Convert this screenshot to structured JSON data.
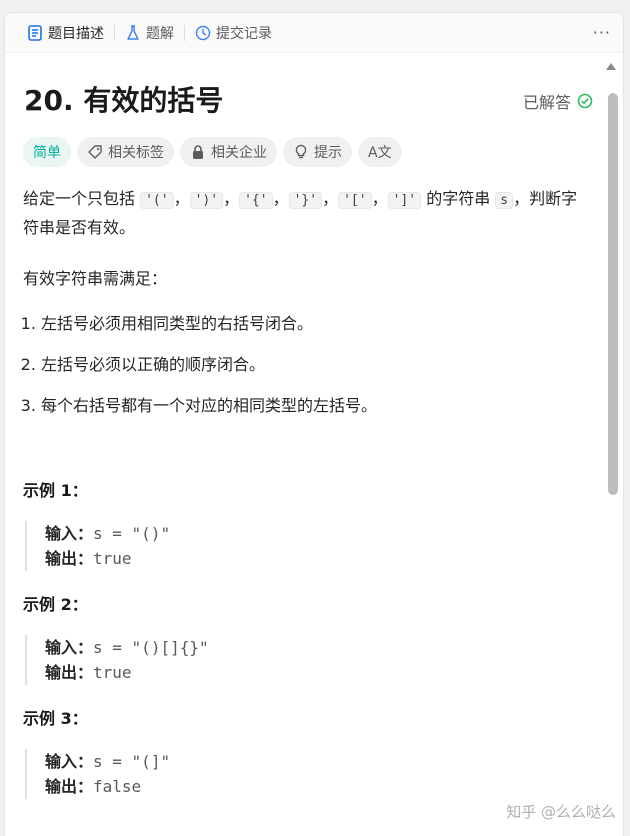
{
  "tabs": [
    {
      "label": "题目描述",
      "icon": "document-icon",
      "active": true
    },
    {
      "label": "题解",
      "icon": "flask-icon",
      "active": false
    },
    {
      "label": "提交记录",
      "icon": "history-icon",
      "active": false
    }
  ],
  "more_label": "···",
  "problem": {
    "title": "20. 有效的括号",
    "status": "已解答",
    "tags": [
      "简单",
      "相关标签",
      "相关企业",
      "提示",
      "A文"
    ],
    "desc_start": "给定一个只包括",
    "chips": [
      "'('",
      "')'",
      "'{'",
      "'}'",
      "'['",
      "']'"
    ],
    "comma": "，",
    "desc_mid": "的字符串",
    "chip_s": "s",
    "desc_end": "，判断字符串是否有效。",
    "requirement": "有效字符串需满足：",
    "rules": [
      "左括号必须用相同类型的右括号闭合。",
      "左括号必须以正确的顺序闭合。",
      "每个右括号都有一个对应的相同类型的左括号。"
    ]
  },
  "examples": [
    {
      "title": "示例 1：",
      "input_label": "输入：",
      "input": "s = \"()\"",
      "output_label": "输出：",
      "output": "true"
    },
    {
      "title": "示例 2：",
      "input_label": "输入：",
      "input": "s = \"()[]{}\"",
      "output_label": "输出：",
      "output": "true"
    },
    {
      "title": "示例 3：",
      "input_label": "输入：",
      "input": "s = \"(]\"",
      "output_label": "输出：",
      "output": "false"
    }
  ],
  "watermark": "知乎 @么么哒么",
  "colors": {
    "easy": "#00af9b",
    "solved_check": "#2cbb5d"
  }
}
